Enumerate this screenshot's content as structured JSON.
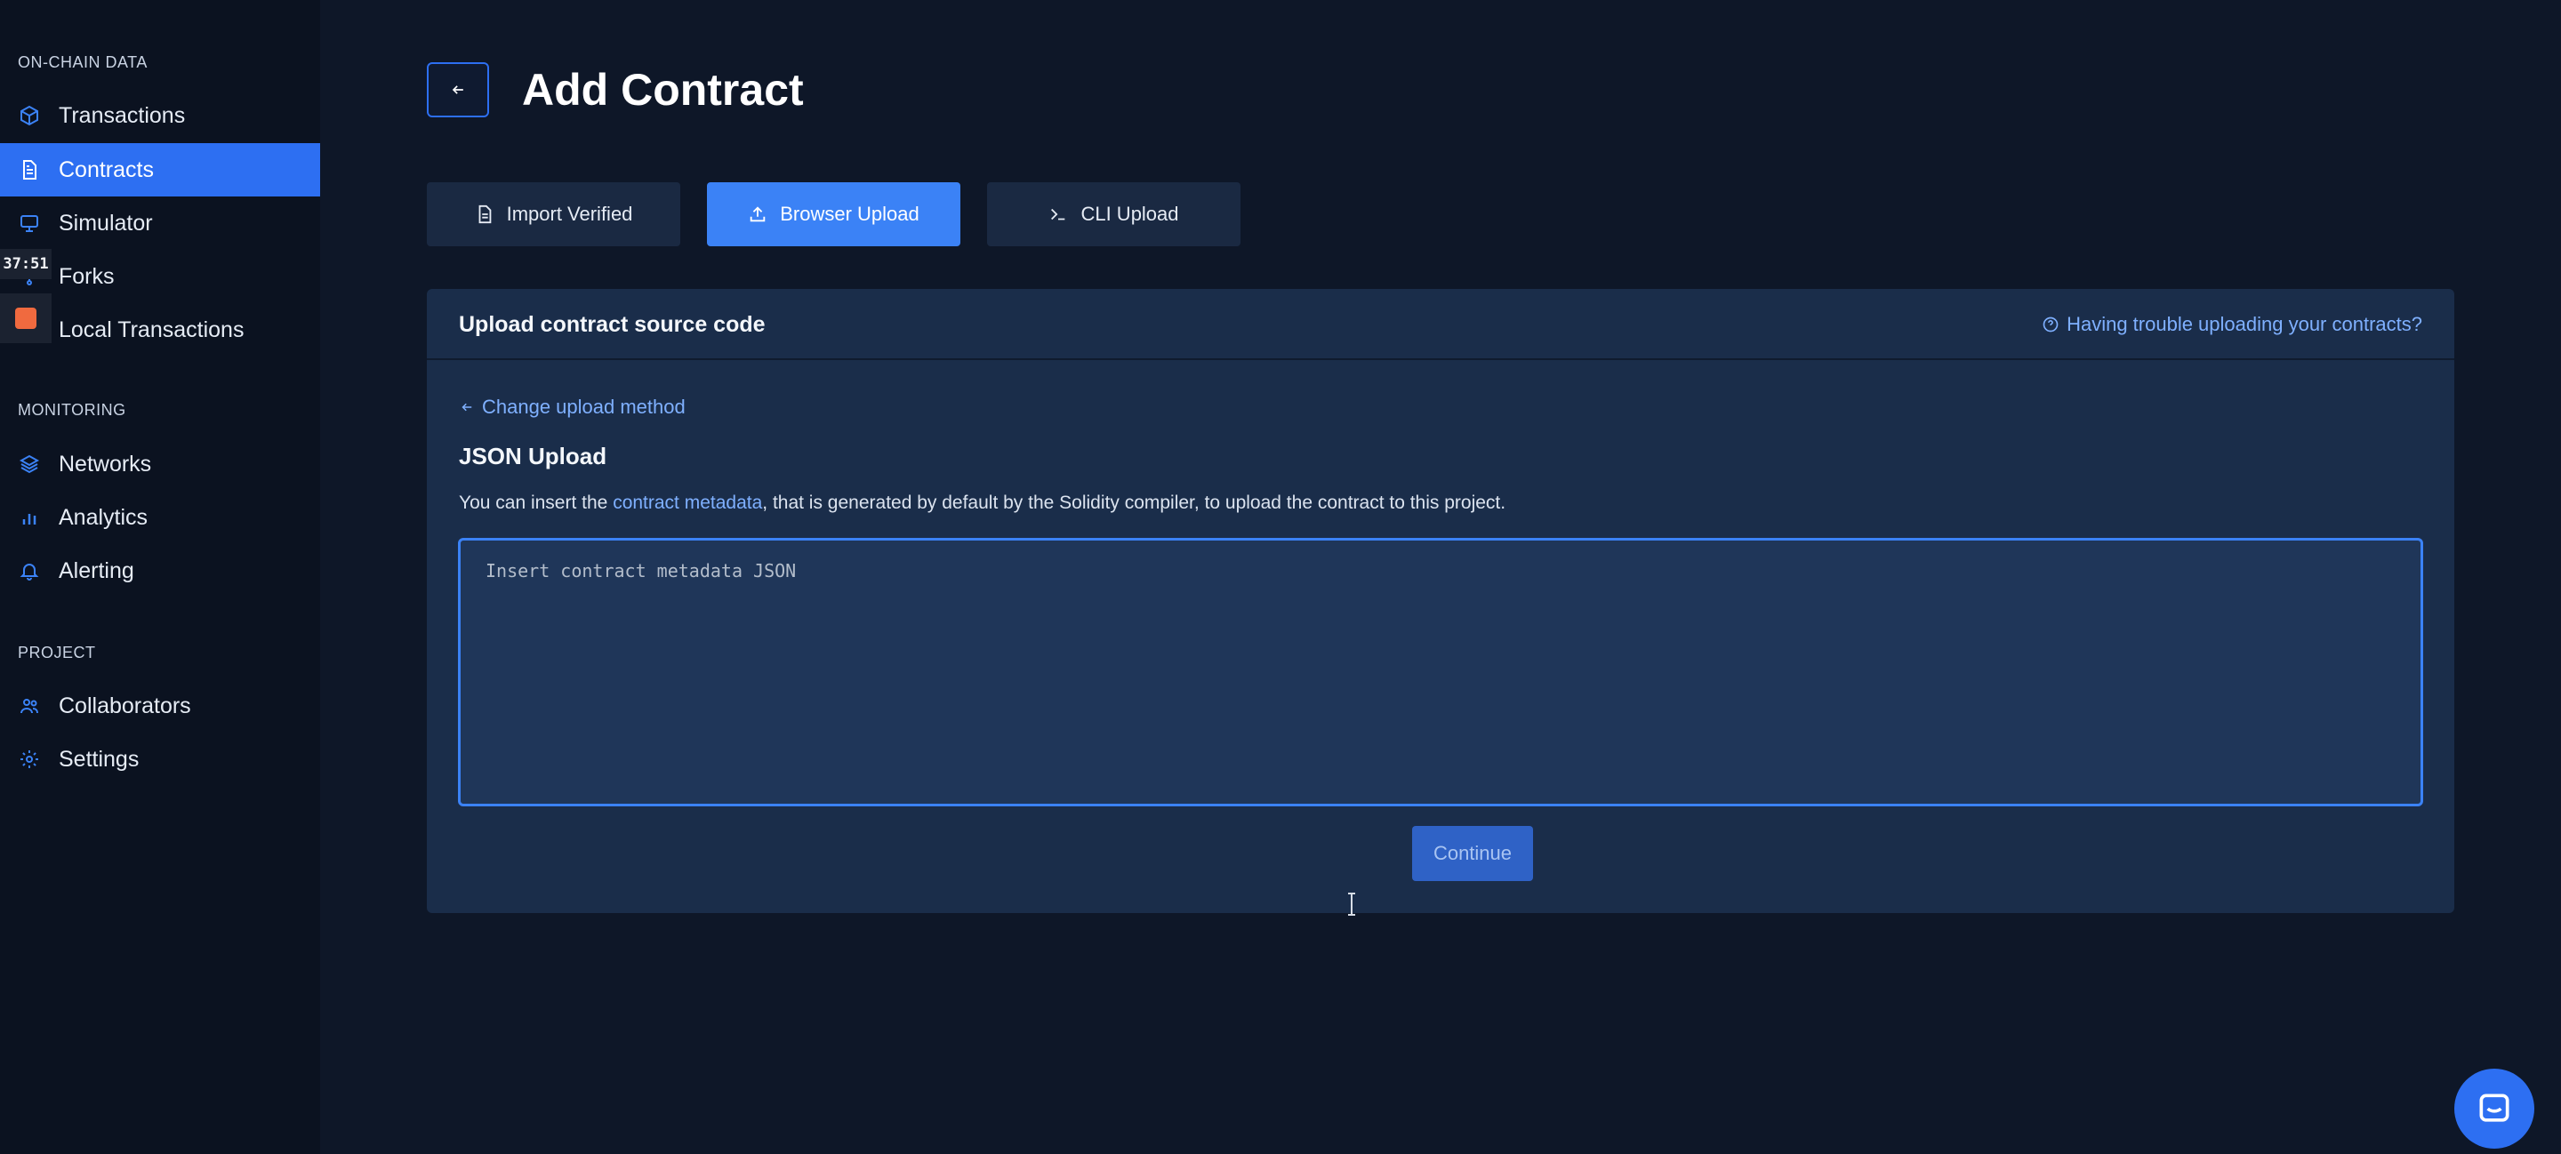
{
  "sidebar": {
    "sections": [
      {
        "title": "ON-CHAIN DATA"
      },
      {
        "title": "MONITORING"
      },
      {
        "title": "PROJECT"
      }
    ],
    "items": [
      {
        "label": "Transactions",
        "icon": "cube-icon"
      },
      {
        "label": "Contracts",
        "icon": "document-icon",
        "active": true
      },
      {
        "label": "Simulator",
        "icon": "monitor-icon"
      },
      {
        "label": "Forks",
        "icon": "fork-icon"
      },
      {
        "label": "Local Transactions",
        "icon": "terminal-icon"
      },
      {
        "label": "Networks",
        "icon": "layers-icon"
      },
      {
        "label": "Analytics",
        "icon": "bar-chart-icon"
      },
      {
        "label": "Alerting",
        "icon": "bell-icon"
      },
      {
        "label": "Collaborators",
        "icon": "users-icon"
      },
      {
        "label": "Settings",
        "icon": "gear-icon"
      }
    ]
  },
  "recording": {
    "timer": "37:51"
  },
  "header": {
    "title": "Add Contract"
  },
  "tabs": [
    {
      "label": "Import Verified",
      "icon": "file-icon"
    },
    {
      "label": "Browser Upload",
      "icon": "upload-icon",
      "active": true
    },
    {
      "label": "CLI Upload",
      "icon": "terminal-prompt-icon"
    }
  ],
  "card": {
    "title": "Upload contract source code",
    "help_link": "Having trouble uploading your contracts?",
    "change_link": "Change upload method",
    "json_title": "JSON Upload",
    "description_prefix": "You can insert the ",
    "description_link": "contract metadata",
    "description_suffix": ", that is generated by default by the Solidity compiler, to upload the contract to this project.",
    "input_placeholder": "Insert contract metadata JSON",
    "input_value": "",
    "continue_label": "Continue"
  },
  "colors": {
    "accent": "#2d6ff2",
    "background": "#0e1728",
    "sidebar": "#0b1220",
    "card": "#1a2d4a",
    "link": "#7fb0ff"
  }
}
